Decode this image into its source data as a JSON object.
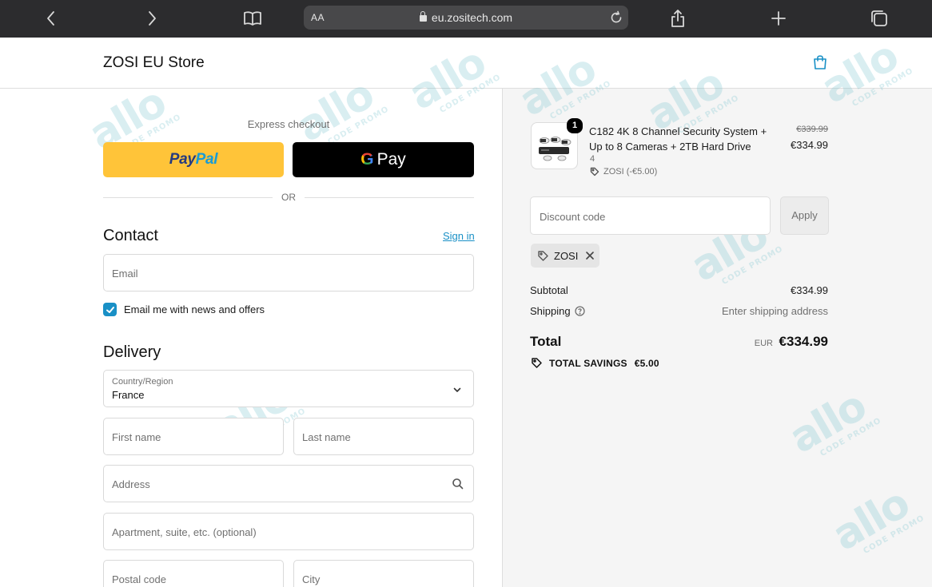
{
  "browser": {
    "text_size_label": "AA",
    "url": "eu.zositech.com"
  },
  "store": {
    "name": "ZOSI EU Store"
  },
  "checkout": {
    "express_label": "Express checkout",
    "paypal": {
      "part1": "Pay",
      "part2": "Pal"
    },
    "gpay": {
      "g": "G",
      "label": "Pay"
    },
    "or_label": "OR",
    "contact": {
      "title": "Contact",
      "signin_label": "Sign in",
      "email_placeholder": "Email",
      "newsletter_label": "Email me with news and offers",
      "newsletter_checked": true
    },
    "delivery": {
      "title": "Delivery",
      "country_label": "Country/Region",
      "country_value": "France",
      "first_name_placeholder": "First name",
      "last_name_placeholder": "Last name",
      "address_placeholder": "Address",
      "apartment_placeholder": "Apartment, suite, etc. (optional)",
      "postal_placeholder": "Postal code",
      "city_placeholder": "City"
    }
  },
  "summary": {
    "product": {
      "quantity_badge": "1",
      "title": "C182 4K 8 Channel Security System + Up to 8 Cameras + 2TB Hard Drive",
      "variant": "4",
      "discount": "ZOSI (-€5.00)",
      "original_price": "€339.99",
      "price": "€334.99"
    },
    "discount_placeholder": "Discount code",
    "apply_label": "Apply",
    "applied_code": "ZOSI",
    "subtotal_label": "Subtotal",
    "subtotal_value": "€334.99",
    "shipping_label": "Shipping",
    "shipping_value": "Enter shipping address",
    "total_label": "Total",
    "total_currency": "EUR",
    "total_value": "€334.99",
    "savings_label": "TOTAL SAVINGS",
    "savings_value": "€5.00"
  },
  "watermark": {
    "big": "allo",
    "small": "CODE PROMO"
  },
  "colors": {
    "accent": "#1990c6",
    "paypal_yellow": "#ffc439",
    "gpay_black": "#000000",
    "browser_bar": "#2c2c2e",
    "summary_bg": "#f5f5f5"
  }
}
